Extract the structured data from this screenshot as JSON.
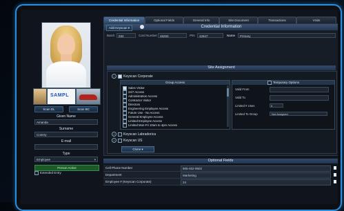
{
  "tabs": [
    "Credential Information",
    "Optional Fields",
    "General Info",
    "Site Document",
    "Transactions",
    "Visits"
  ],
  "header": {
    "add_keyscan_label": "Add Keyscan",
    "title": "Credential Information"
  },
  "credential": {
    "batch_label": "Batch",
    "batch_value": "032",
    "card_label": "Card Number",
    "card_value": "48293",
    "pin_label": "PIN",
    "pin_value": "42847",
    "name_label": "Name",
    "name_value": "Primary"
  },
  "site": {
    "title": "Site Assignment",
    "companies": [
      "Keyscan Corporate",
      "Keyscan Labradorica",
      "Keyscan US"
    ],
    "group_access_title": "Group Access",
    "groups": [
      "Sales Visitor",
      "24/7 Access",
      "Administration Access",
      "Contractor Visitor",
      "Directors",
      "Engineering Employee Access",
      "Future Use - No Access",
      "General Employee Access",
      "Limited Employee Access",
      "Limited Mon-Fri 10am to 4pm Access"
    ],
    "temp_options_title": "Temporary Options",
    "temp_options": [
      {
        "label": "Valid From",
        "value": ""
      },
      {
        "label": "Valid To",
        "value": ""
      },
      {
        "label": "Limited # Uses",
        "value": "0"
      },
      {
        "label": "Limited To Group",
        "value": "Not Assigned"
      }
    ],
    "clone_label": "Clone"
  },
  "left": {
    "scan_left": "Scan DL",
    "scan_right": "Scan BC",
    "plate_text": "SAMPL",
    "given_name_label": "Given Name",
    "given_name_value": "Amanda",
    "surname_label": "Surname",
    "surname_value": "Conery",
    "email_label": "E-mail",
    "email_value": "",
    "type_label": "Type",
    "type_value": "Employee",
    "person_active_label": "Person Active",
    "extended_entry_label": "Extended Entry"
  },
  "optional": {
    "title": "Optional Fields",
    "rows": [
      {
        "key": "Cell Phone Number",
        "value": "905-462-9502"
      },
      {
        "key": "Department",
        "value": "Marketing"
      },
      {
        "key": "Employee #  (Keyscan Corporate)",
        "value": "24"
      }
    ]
  }
}
